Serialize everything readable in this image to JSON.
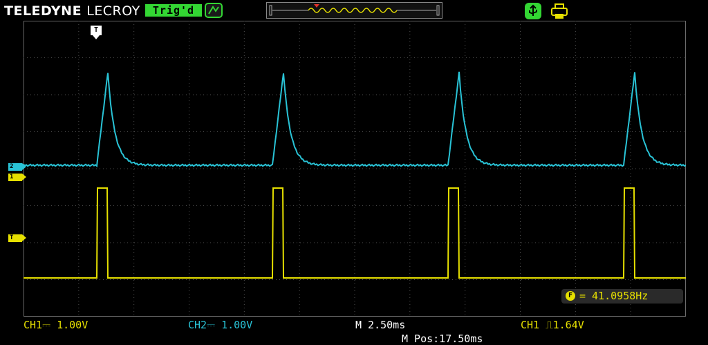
{
  "header": {
    "brand_bold": "TELEDYNE",
    "brand_light": "LECROY",
    "trigger_status": "Trig'd",
    "trigger_status_color": "#33d633",
    "icons": [
      "trigger-type-icon",
      "waveform-overview-icon",
      "usb-icon",
      "printer-icon"
    ]
  },
  "markers": {
    "ch2": "2",
    "ch1": "1",
    "trigger_level": "T",
    "trigger_position": "T"
  },
  "measurement": {
    "label": "F",
    "value": "= 41.0958Hz"
  },
  "status": {
    "ch1": "CH1⎓ 1.00V",
    "ch2": "CH2⎓ 1.00V",
    "timebase": "M 2.50ms",
    "trigger": "CH1 ⎍1.64V",
    "position": "M Pos:17.50ms"
  },
  "colors": {
    "ch1": "#e6e000",
    "ch2": "#29c3d6",
    "grid": "#5a5a5a",
    "background": "#000000"
  }
}
